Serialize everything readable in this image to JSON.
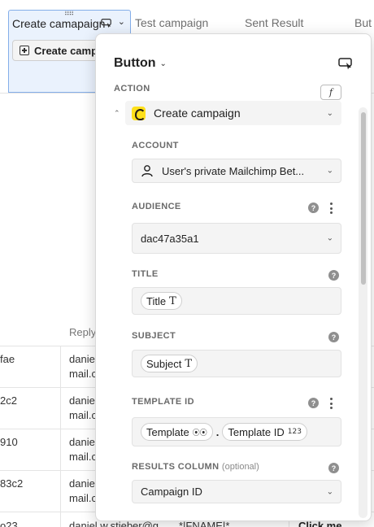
{
  "table": {
    "columns": [
      {
        "label": "Create camapaign",
        "selected": true
      },
      {
        "label": "Test campaign"
      },
      {
        "label": "Sent Result"
      },
      {
        "label": "But"
      }
    ],
    "cell_button_label": "Create camp",
    "reply_header": "Reply",
    "rows": [
      {
        "id": "fae",
        "reply1": "danie",
        "reply2": "mail.c"
      },
      {
        "id": "2c2",
        "reply1": "danie",
        "reply2": "mail.c"
      },
      {
        "id": "910",
        "reply1": "danie",
        "reply2": "mail.c"
      },
      {
        "id": "83c2",
        "reply1": "danie",
        "reply2": "mail.c"
      },
      {
        "id": "o23",
        "reply1": "daniel.w.stieber@g",
        "merge": "*|FNAME|*",
        "action": "Click me"
      }
    ]
  },
  "panel": {
    "title": "Button",
    "action_label": "ACTION",
    "fx_label": "f",
    "action_value": "Create campaign",
    "account": {
      "label": "ACCOUNT",
      "value": "User's private Mailchimp Bet..."
    },
    "audience": {
      "label": "AUDIENCE",
      "value": "dac47a35a1"
    },
    "title_field": {
      "label": "TITLE",
      "pill": "Title",
      "pill_icon": "T"
    },
    "subject": {
      "label": "SUBJECT",
      "pill": "Subject",
      "pill_icon": "T"
    },
    "template_id": {
      "label": "TEMPLATE ID",
      "pill1": "Template",
      "pill1_icon": "⦿⦿",
      "separator": ".",
      "pill2": "Template ID",
      "pill2_icon": "123"
    },
    "results_column": {
      "label": "RESULTS COLUMN",
      "optional": "(optional)",
      "value": "Campaign ID"
    }
  },
  "colors": {
    "accent": "#84aee9",
    "selected_bg": "#eaf2fd",
    "mailchimp": "#ffe01b"
  }
}
